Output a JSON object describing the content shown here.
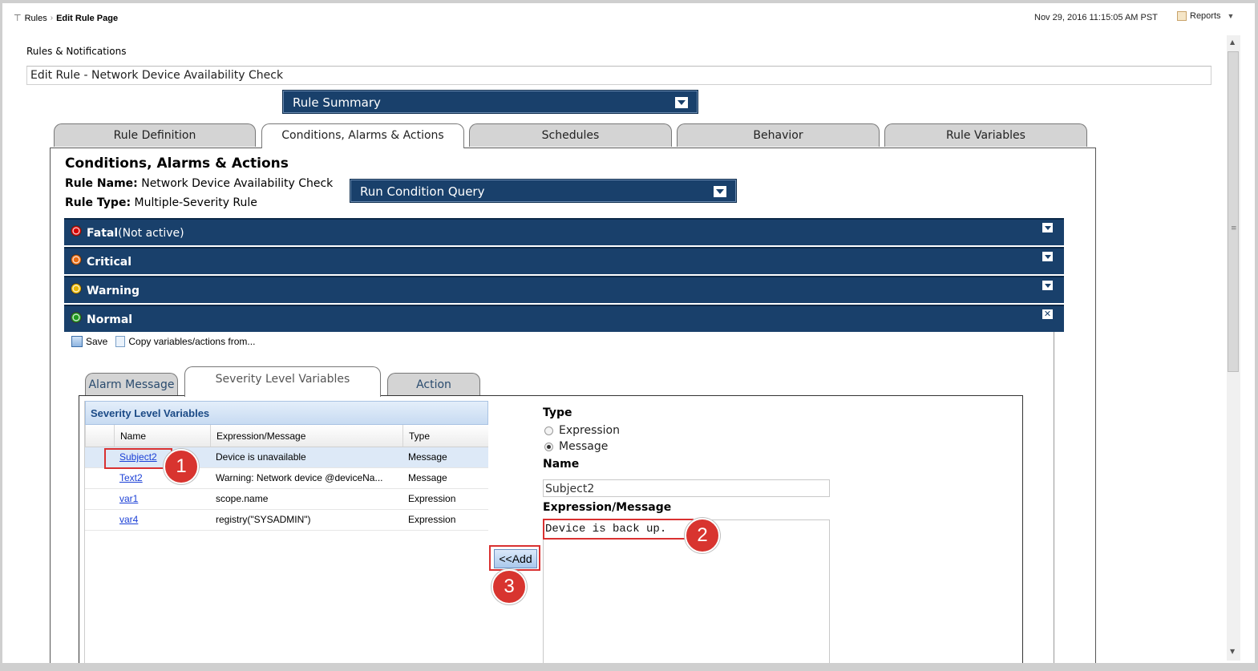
{
  "breadcrumb": {
    "home": "Rules",
    "current": "Edit Rule Page"
  },
  "timestamp": "Nov 29, 2016 11:15:05 AM PST",
  "reports_label": "Reports",
  "section_label": "Rules & Notifications",
  "page_title": "Edit Rule - Network Device Availability Check",
  "rule_summary_dropdown": "Rule Summary",
  "tabs": [
    "Rule Definition",
    "Conditions, Alarms & Actions",
    "Schedules",
    "Behavior",
    "Rule Variables"
  ],
  "active_tab": "Conditions, Alarms & Actions",
  "content": {
    "heading": "Conditions, Alarms & Actions",
    "rule_name_label": "Rule Name:",
    "rule_name": "Network Device Availability Check",
    "rule_type_label": "Rule Type:",
    "rule_type": "Multiple-Severity Rule",
    "run_query": "Run Condition Query"
  },
  "severities": [
    {
      "label": "Fatal",
      "note": "(Not active)",
      "color": "#d40000"
    },
    {
      "label": "Critical",
      "note": "",
      "color": "#e86a10"
    },
    {
      "label": "Warning",
      "note": "",
      "color": "#e8b400"
    },
    {
      "label": "Normal",
      "note": "",
      "color": "#1f9a1f"
    }
  ],
  "toolbar": {
    "save": "Save",
    "copy": "Copy variables/actions from..."
  },
  "subtabs": [
    "Alarm Message",
    "Severity Level Variables",
    "Action"
  ],
  "grid": {
    "title": "Severity Level Variables",
    "columns": [
      "Name",
      "Expression/Message",
      "Type"
    ],
    "rows": [
      {
        "name": "Subject2",
        "expr": "Device is unavailable",
        "type": "Message"
      },
      {
        "name": "Text2",
        "expr": "Warning: Network device @deviceNa...",
        "type": "Message"
      },
      {
        "name": "var1",
        "expr": "scope.name",
        "type": "Expression"
      },
      {
        "name": "var4",
        "expr": "registry(\"SYSADMIN\")",
        "type": "Expression"
      }
    ]
  },
  "form": {
    "type_label": "Type",
    "opt_expression": "Expression",
    "opt_message": "Message",
    "name_label": "Name",
    "name_value": "Subject2",
    "expr_label": "Expression/Message",
    "expr_value": "Device is back up."
  },
  "add_button": "<<Add",
  "callouts": [
    "1",
    "2",
    "3"
  ]
}
